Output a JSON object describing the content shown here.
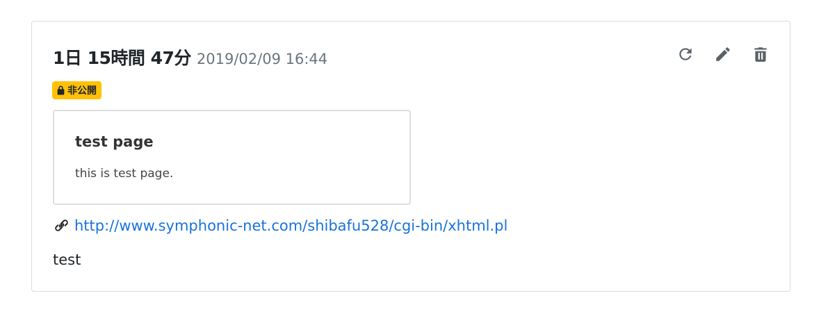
{
  "entry": {
    "duration": "1日 15時間 47分",
    "timestamp": "2019/02/09 16:44",
    "badge": {
      "icon": "lock-icon",
      "label": "非公開",
      "color": "#ffc107"
    },
    "actions": [
      {
        "name": "refresh",
        "icon": "refresh-icon"
      },
      {
        "name": "edit",
        "icon": "pencil-icon"
      },
      {
        "name": "delete",
        "icon": "trash-icon"
      }
    ],
    "preview": {
      "title": "test page",
      "description": "this is test page."
    },
    "link": {
      "icon": "link-icon",
      "url": "http://www.symphonic-net.com/shibafu528/cgi-bin/xhtml.pl",
      "color": "#1a73d9"
    },
    "note": "test"
  }
}
